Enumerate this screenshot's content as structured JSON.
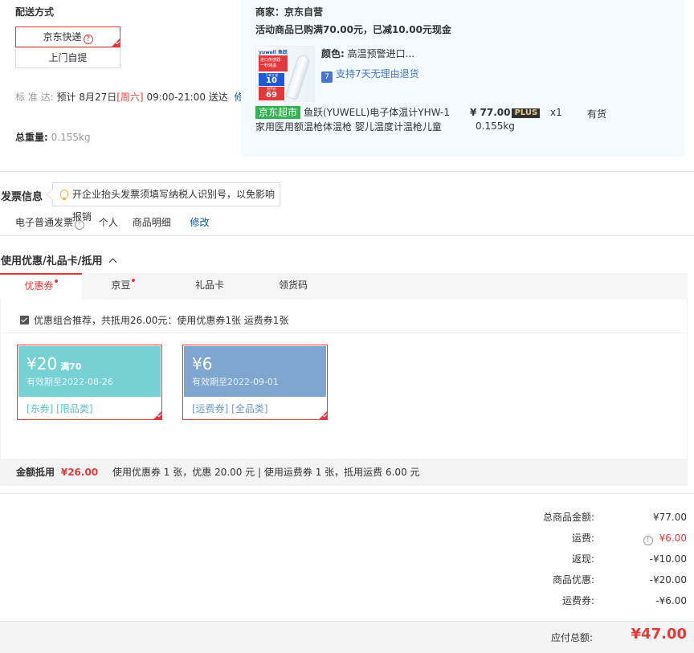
{
  "delivery": {
    "title": "配送方式",
    "options": [
      "京东快递",
      "上门自提"
    ],
    "help_glyph": "?",
    "arrival_label": "标 准 达:",
    "arrival_prefix": "预计 8月27日",
    "arrival_day": "[周六]",
    "arrival_suffix": "09:00-21:00 送达",
    "modify": "修改",
    "weight_label": "总重量:",
    "weight_value": "0.155kg"
  },
  "merchant": {
    "name": "商家：京东自营",
    "promo": "活动商品已购满70.00元，已减10.00元现金",
    "color_label": "颜色:",
    "color_value": "高温预警进口...",
    "return_glyph": "7",
    "return_text": "支持7天无理由退货",
    "badge": "京东超市",
    "product_title_1": "鱼跃(YUWELL)电子体温计YHW-1",
    "product_title_2": "家用医用额温枪体温枪 婴儿温度计温枪儿童",
    "price": "¥ 77.00",
    "plus": "PLUS",
    "qty": "x1",
    "stock": "有货",
    "item_weight": "0.155kg",
    "img": {
      "brand": "yuwell 鱼跃",
      "line1": "进口传感器",
      "line2": "一秒测温",
      "pill": "下单立减",
      "num1": "10",
      "pill2": "到手价",
      "num2": "69"
    }
  },
  "invoice": {
    "title": "发票信息",
    "tip": "开企业抬头发票须填写纳税人识别号，以免影响报销",
    "type": "电子普通发票",
    "info_glyph": "!",
    "person": "个人",
    "detail": "商品明细",
    "modify": "修改"
  },
  "coupons": {
    "title": "使用优惠/礼品卡/抵用",
    "tabs": [
      "优惠券",
      "京豆",
      "礼品卡",
      "领货码"
    ],
    "recommend": "优惠组合推荐，共抵用26.00元：使用优惠券1张 运费券1张",
    "items": [
      {
        "amount": "¥20",
        "cond": "满70",
        "expiry": "有效期至2022-08-26",
        "tags": "[东券]   [限品类]"
      },
      {
        "amount": "¥6",
        "cond": "",
        "expiry": "有效期至2022-09-01",
        "tags": "[运费券]   [全品类]"
      }
    ],
    "summary_label": "金额抵用",
    "summary_amount": "¥26.00",
    "summary_detail": "使用优惠券 1 张，优惠 20.00 元  | 使用运费券 1 张，抵用运费 6.00 元"
  },
  "totals": {
    "rows": [
      {
        "label": "总商品金额:",
        "value": "¥77.00"
      },
      {
        "label": "运费:",
        "value": "¥6.00"
      },
      {
        "label": "返现:",
        "value": "-¥10.00"
      },
      {
        "label": "商品优惠:",
        "value": "-¥20.00"
      },
      {
        "label": "运费券:",
        "value": "-¥6.00"
      }
    ],
    "fee_glyph": "!",
    "payable_label": "应付总额:",
    "payable_value": "¥47.00"
  },
  "colors": {
    "accent": "#e4393c",
    "coupon_teal": "#76d0d4",
    "coupon_blue": "#7ea6cf",
    "merchant_bg": "#f3fbfe",
    "link": "#005aa0"
  }
}
